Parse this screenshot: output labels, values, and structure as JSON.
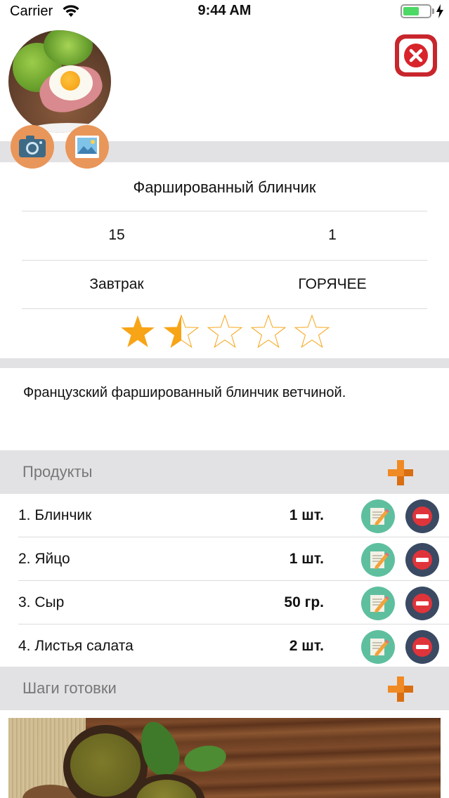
{
  "status_bar": {
    "carrier": "Carrier",
    "time": "9:44 AM",
    "battery_level": 0.6,
    "icons": [
      "wifi-icon",
      "battery-icon",
      "charging-bolt-icon"
    ]
  },
  "header": {
    "photo": "recipe-photo",
    "buttons": {
      "camera": "camera-icon",
      "gallery": "gallery-icon",
      "close": "close-icon"
    }
  },
  "recipe": {
    "name": "Фаршированный блинчик",
    "time": "15",
    "servings": "1",
    "category": "Завтрак",
    "type": "ГОРЯЧЕЕ",
    "rating": 1.5,
    "rating_max": 5,
    "description": "Французский фаршированный блинчик ветчиной."
  },
  "products": {
    "title": "Продукты",
    "items": [
      {
        "name": "1. Блинчик",
        "qty": "1 шт."
      },
      {
        "name": "2. Яйцо",
        "qty": "1 шт."
      },
      {
        "name": "3. Сыр",
        "qty": "50 гр."
      },
      {
        "name": "4. Листья салата",
        "qty": "2 шт."
      }
    ]
  },
  "steps": {
    "title": "Шаги готовки"
  },
  "colors": {
    "section_bg": "#e2e2e4",
    "accent_orange": "#f08a24",
    "star": "#f7a416",
    "edit_bg": "#5ebf9f",
    "delete_bg": "#3b4a63",
    "close_red": "#c8262c"
  }
}
